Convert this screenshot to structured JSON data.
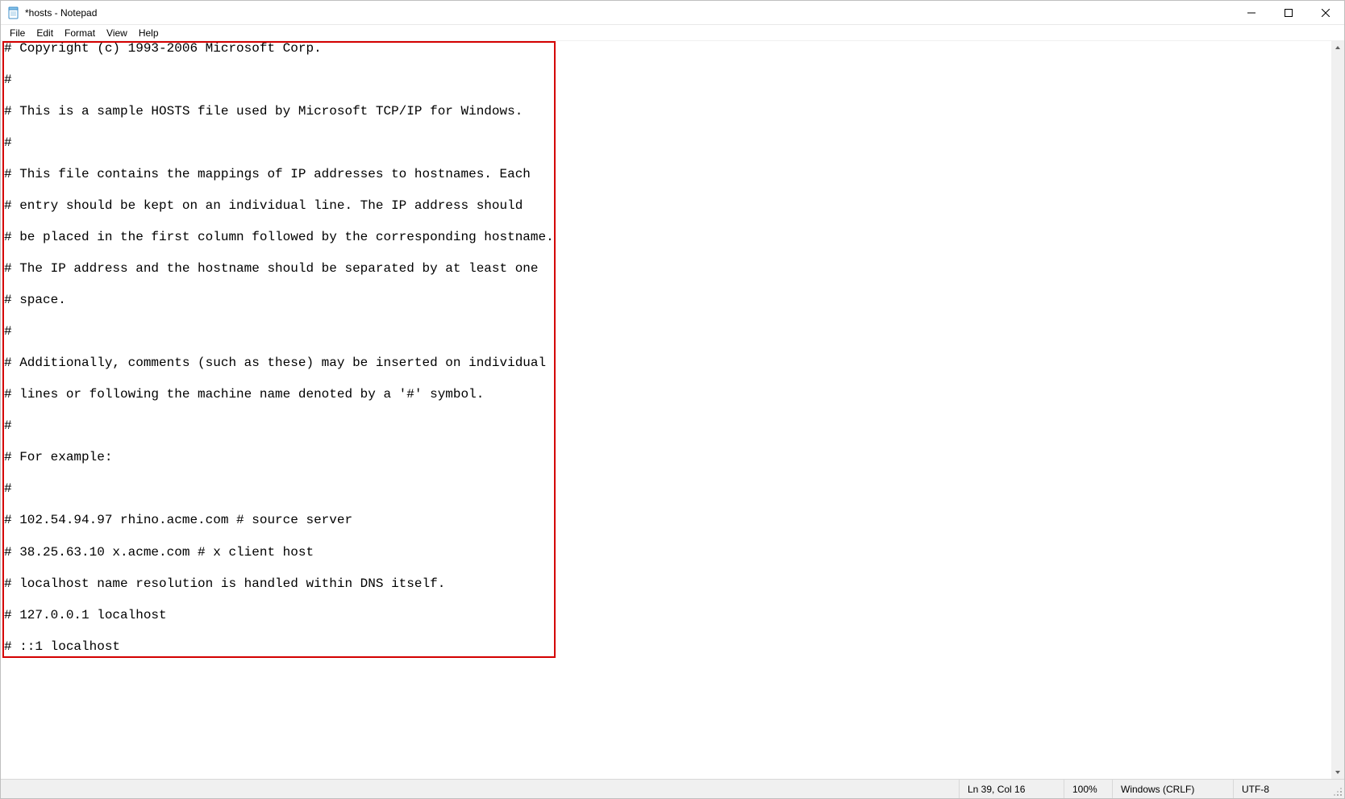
{
  "window": {
    "title": "*hosts - Notepad"
  },
  "menu": {
    "file": "File",
    "edit": "Edit",
    "format": "Format",
    "view": "View",
    "help": "Help"
  },
  "editor": {
    "text": "# Copyright (c) 1993-2006 Microsoft Corp.\n\n#\n\n# This is a sample HOSTS file used by Microsoft TCP/IP for Windows.\n\n#\n\n# This file contains the mappings of IP addresses to hostnames. Each\n\n# entry should be kept on an individual line. The IP address should\n\n# be placed in the first column followed by the corresponding hostname.\n\n# The IP address and the hostname should be separated by at least one\n\n# space.\n\n#\n\n# Additionally, comments (such as these) may be inserted on individual\n\n# lines or following the machine name denoted by a '#' symbol.\n\n#\n\n# For example:\n\n#\n\n# 102.54.94.97 rhino.acme.com # source server\n\n# 38.25.63.10 x.acme.com # x client host\n\n# localhost name resolution is handled within DNS itself.\n\n# 127.0.0.1 localhost\n\n# ::1 localhost"
  },
  "statusbar": {
    "position": "Ln 39, Col 16",
    "zoom": "100%",
    "line_ending": "Windows (CRLF)",
    "encoding": "UTF-8"
  }
}
